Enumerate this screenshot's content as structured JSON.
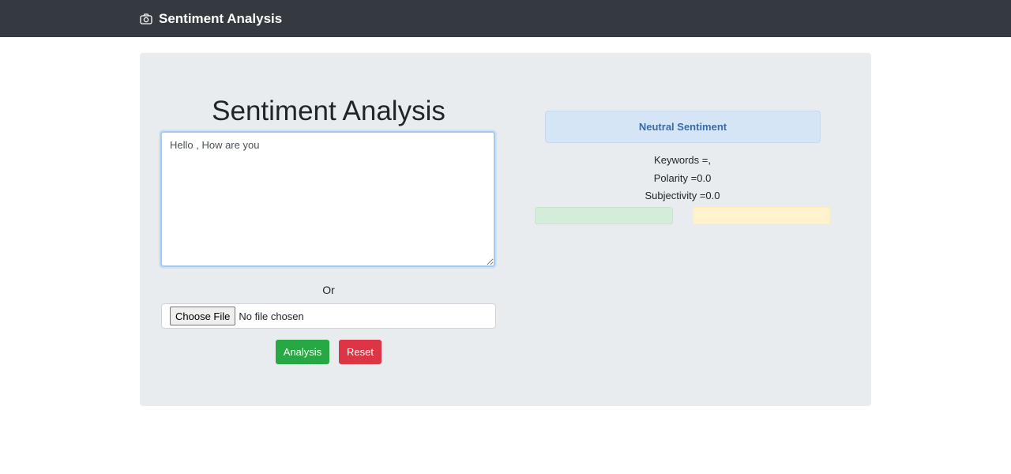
{
  "navbar": {
    "brand_label": "Sentiment Analysis",
    "brand_icon": "camera-icon"
  },
  "main": {
    "title": "Sentiment Analysis",
    "textarea_value": "Hello , How are you",
    "or_label": "Or",
    "file_input": {
      "button_label": "Choose File",
      "status": "No file chosen"
    },
    "buttons": {
      "analysis": "Analysis",
      "reset": "Reset"
    }
  },
  "result": {
    "sentiment_label": "Neutral Sentiment",
    "keywords": "Keywords =,",
    "polarity": "Polarity =0.0",
    "subjectivity": "Subjectivity =0.0"
  },
  "colors": {
    "navbar": "#343a40",
    "panel": "#e9ecef",
    "success": "#28a745",
    "danger": "#dc3545",
    "info_alert": "#d6e5f5",
    "success_alert": "#d4edda",
    "warning_alert": "#fff3cd"
  }
}
